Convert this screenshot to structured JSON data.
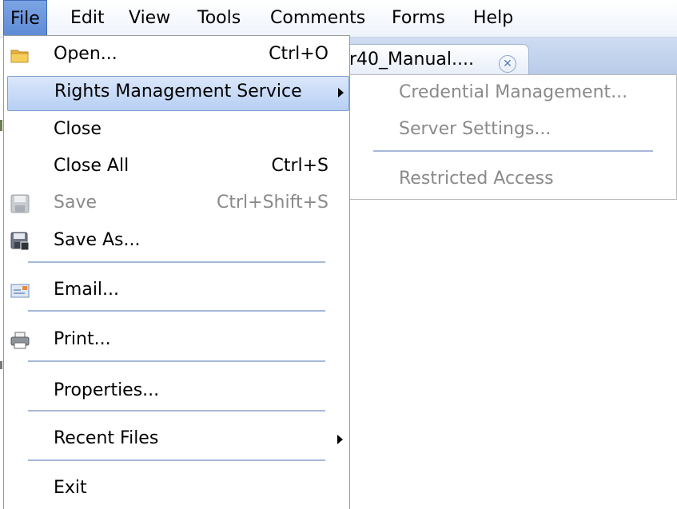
{
  "menubar": {
    "items": [
      {
        "label": "File",
        "active": true
      },
      {
        "label": "Edit"
      },
      {
        "label": "View"
      },
      {
        "label": "Tools"
      },
      {
        "label": "Comments"
      },
      {
        "label": "Forms"
      },
      {
        "label": "Help"
      }
    ]
  },
  "document_tab": {
    "label": "r40_Manual....",
    "close_icon": "close-circle-icon"
  },
  "file_menu": {
    "items": [
      {
        "label": "Open...",
        "shortcut": "Ctrl+O",
        "icon": "folder-icon"
      },
      {
        "label": "Rights Management Service",
        "submenu": true,
        "highlighted": true
      },
      {
        "label": "Close"
      },
      {
        "label": "Close All",
        "shortcut": "Ctrl+S"
      },
      {
        "label": "Save",
        "shortcut": "Ctrl+Shift+S",
        "icon": "save-icon",
        "disabled": true
      },
      {
        "label": "Save As...",
        "icon": "save-as-icon"
      },
      {
        "label": "Email...",
        "icon": "email-icon"
      },
      {
        "label": "Print...",
        "icon": "printer-icon"
      },
      {
        "label": "Properties..."
      },
      {
        "label": "Recent Files",
        "submenu": true
      },
      {
        "label": "Exit"
      }
    ]
  },
  "rights_submenu": {
    "items": [
      {
        "label": "Credential Management...",
        "disabled": true
      },
      {
        "label": "Server Settings...",
        "disabled": true
      },
      {
        "label": "Restricted Access",
        "disabled": true
      }
    ]
  },
  "colors": {
    "menu_highlight": "#b7cff3",
    "active_menubar": "#5d8bd6",
    "disabled_text": "#8a8a8a",
    "separator": "#a6b8d8"
  }
}
